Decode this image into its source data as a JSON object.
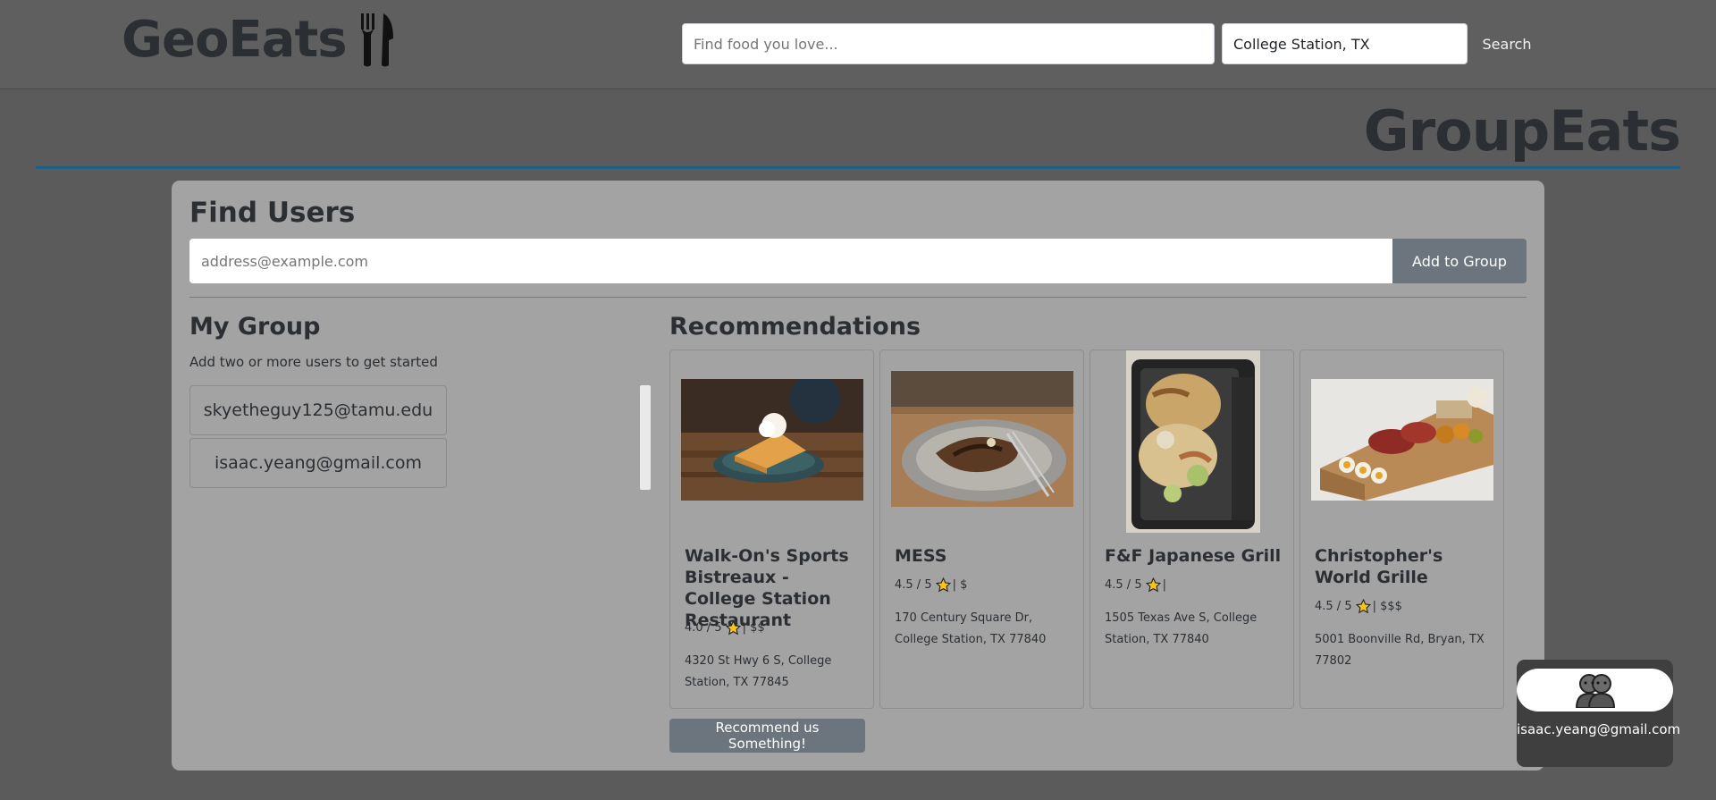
{
  "header": {
    "logo_text": "GeoEats",
    "search_food_placeholder": "Find food you love...",
    "search_location_value": "College Station, TX",
    "search_button": "Search"
  },
  "page": {
    "title": "GroupEats"
  },
  "find_users": {
    "title": "Find Users",
    "email_placeholder": "address@example.com",
    "add_button": "Add to Group"
  },
  "my_group": {
    "title": "My Group",
    "hint": "Add two or more users to get started",
    "members": [
      "skyetheguy125@tamu.edu",
      "isaac.yeang@gmail.com"
    ]
  },
  "recommendations": {
    "title": "Recommendations",
    "items": [
      {
        "name": "Walk-On's Sports Bistreaux - College Station Restaurant",
        "rating": "4.0 / 5",
        "price": "| $$",
        "address": "4320 St Hwy 6 S, College Station, TX 77845",
        "image": "dessert-on-plate"
      },
      {
        "name": "MESS",
        "rating": "4.5 / 5",
        "price": "| $",
        "address": "170 Century Square Dr, College Station, TX 77840",
        "image": "waffle-plate"
      },
      {
        "name": "F&F Japanese Grill",
        "rating": "4.5 / 5",
        "price": "|",
        "address": "1505 Texas Ave S, College Station, TX 77840",
        "image": "takeout-box"
      },
      {
        "name": "Christopher's World Grille",
        "rating": "4.5 / 5",
        "price": "| $$$",
        "address": "5001 Boonville Rd, Bryan, TX 77802",
        "image": "charcuterie-board"
      }
    ],
    "recommend_button": "Recommend us Something!"
  },
  "user_badge": {
    "email": "isaac.yeang@gmail.com",
    "icon": "users-icon"
  },
  "colors": {
    "accent_rule": "#1f5f86",
    "button_gray": "#6c757d",
    "star": "#f5c518"
  }
}
